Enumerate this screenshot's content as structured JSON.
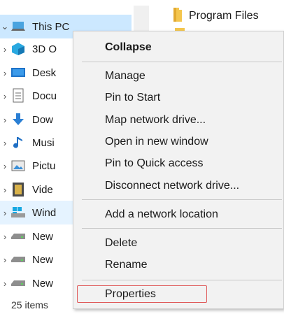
{
  "navigation_pane": {
    "items": [
      {
        "label": "This PC",
        "icon": "computer-icon",
        "chevron": "expanded"
      },
      {
        "label": "3D O",
        "icon": "3d-objects-icon",
        "chevron": "collapsed"
      },
      {
        "label": "Desk",
        "icon": "desktop-icon",
        "chevron": "collapsed"
      },
      {
        "label": "Docu",
        "icon": "documents-icon",
        "chevron": "collapsed"
      },
      {
        "label": "Dow",
        "icon": "downloads-icon",
        "chevron": "collapsed"
      },
      {
        "label": "Musi",
        "icon": "music-icon",
        "chevron": "collapsed"
      },
      {
        "label": "Pictu",
        "icon": "pictures-icon",
        "chevron": "collapsed"
      },
      {
        "label": "Vide",
        "icon": "videos-icon",
        "chevron": "collapsed"
      },
      {
        "label": "Wind",
        "icon": "windows-drive-icon",
        "chevron": "collapsed"
      },
      {
        "label": "New",
        "icon": "drive-icon",
        "chevron": "collapsed"
      },
      {
        "label": "New",
        "icon": "drive-icon",
        "chevron": "collapsed"
      },
      {
        "label": "New",
        "icon": "drive-icon",
        "chevron": "collapsed"
      }
    ]
  },
  "content": {
    "items": [
      {
        "label": "Program Files",
        "icon": "folder-icon"
      }
    ]
  },
  "status_bar": {
    "item_count": "25 items"
  },
  "context_menu": {
    "items": [
      {
        "label": "Collapse",
        "bold": true
      },
      {
        "label": "Manage"
      },
      {
        "label": "Pin to Start"
      },
      {
        "label": "Map network drive..."
      },
      {
        "label": "Open in new window"
      },
      {
        "label": "Pin to Quick access"
      },
      {
        "label": "Disconnect network drive..."
      },
      {
        "label": "Add a network location"
      },
      {
        "label": "Delete"
      },
      {
        "label": "Rename"
      },
      {
        "label": "Properties",
        "highlighted": true
      }
    ]
  },
  "colors": {
    "selection": "#cce8ff",
    "hover": "#e5f3ff",
    "menu_background": "#f2f2f2",
    "highlight_border": "#e05a5a"
  }
}
